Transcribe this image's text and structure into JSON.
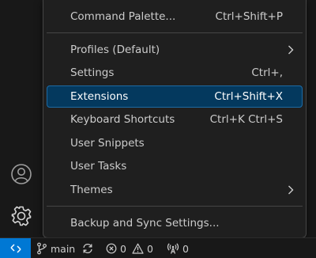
{
  "menu": {
    "items": [
      {
        "id": "command-palette",
        "label": "Command Palette...",
        "keybinding": "Ctrl+Shift+P"
      },
      {
        "id": "profiles",
        "label": "Profiles (Default)",
        "keybinding": "",
        "submenu": true
      },
      {
        "id": "settings",
        "label": "Settings",
        "keybinding": "Ctrl+,"
      },
      {
        "id": "extensions",
        "label": "Extensions",
        "keybinding": "Ctrl+Shift+X",
        "selected": true
      },
      {
        "id": "keyboard-shortcuts",
        "label": "Keyboard Shortcuts",
        "keybinding": "Ctrl+K Ctrl+S"
      },
      {
        "id": "user-snippets",
        "label": "User Snippets",
        "keybinding": ""
      },
      {
        "id": "user-tasks",
        "label": "User Tasks",
        "keybinding": ""
      },
      {
        "id": "themes",
        "label": "Themes",
        "keybinding": "",
        "submenu": true
      },
      {
        "id": "backup-sync",
        "label": "Backup and Sync Settings...",
        "keybinding": ""
      }
    ]
  },
  "activity_bar": {
    "icons": [
      "account-icon",
      "gear-icon"
    ]
  },
  "status_bar": {
    "branch": "main",
    "errors": "0",
    "warnings": "0",
    "ports": "0",
    "remote_color": "#0078d4"
  },
  "colors": {
    "menu_bg": "#1f1f1f",
    "selected_bg": "#04395e",
    "text": "#cccccc",
    "accent": "#0078d4"
  }
}
